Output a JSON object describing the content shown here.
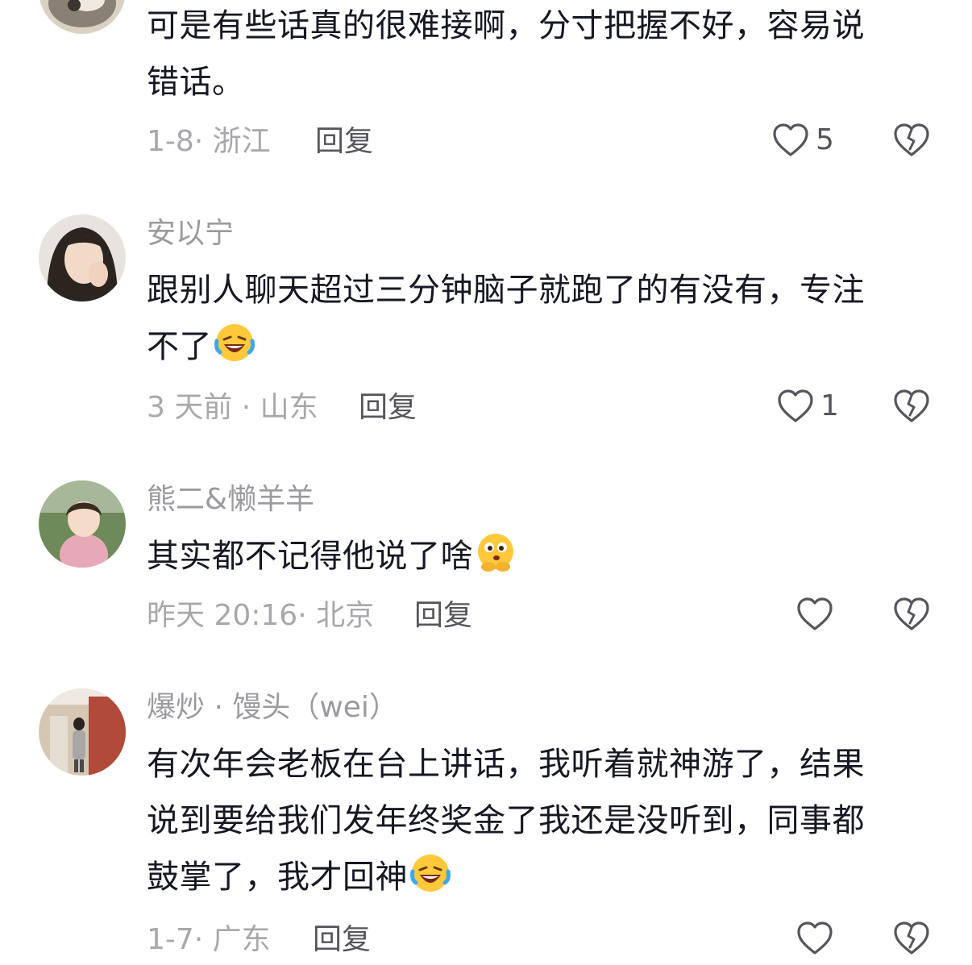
{
  "comments": [
    {
      "username": "",
      "text_lines": [
        "可是有些话真的很难接啊，分寸把握不好，容易说",
        "错话。"
      ],
      "emoji": "",
      "meta": "1-8· 浙江",
      "reply_label": "回复",
      "likes": "5"
    },
    {
      "username": "安以宁",
      "text_lines": [
        "跟别人聊天超过三分钟脑子就跑了的有没有，专注",
        "不了"
      ],
      "emoji": "laughing-crying-emoji",
      "meta": "3 天前 · 山东",
      "reply_label": "回复",
      "likes": "1"
    },
    {
      "username": "熊二&懒羊羊",
      "text_lines": [
        "其实都不记得他说了啥"
      ],
      "emoji": "thinking-emoji",
      "meta": "昨天 20:16· 北京",
      "reply_label": "回复",
      "likes": ""
    },
    {
      "username": "爆炒 · 馒头（wei）",
      "text_lines": [
        "有次年会老板在台上讲话，我听着就神游了，结果",
        "说到要给我们发年终奖金了我还是没听到，同事都",
        "鼓掌了，我才回神"
      ],
      "emoji": "laughing-crying-emoji",
      "meta": "1-7· 广东",
      "reply_label": "回复",
      "likes": ""
    }
  ],
  "colors": {
    "text": "#161823",
    "secondary": "#9a9b9f",
    "action": "#55565c"
  }
}
